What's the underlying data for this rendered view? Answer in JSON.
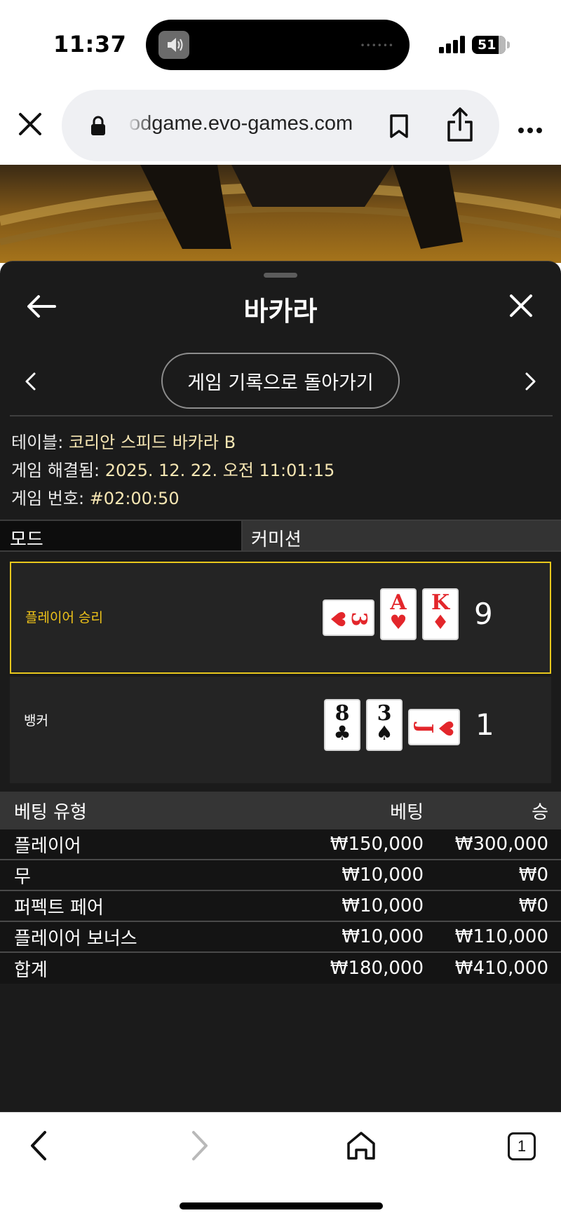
{
  "status": {
    "time": "11:37",
    "battery": "51"
  },
  "browser": {
    "url": "odgame.evo-games.com",
    "tabs_count": "1"
  },
  "panel": {
    "title": "바카라",
    "back_to_history": "게임 기록으로 돌아가기",
    "info": {
      "table_label": "테이블:",
      "table_value": "코리안 스피드 바카라 B",
      "resolved_label": "게임 해결됨:",
      "resolved_value": "2025. 12. 22. 오전 11:01:15",
      "game_no_label": "게임 번호:",
      "game_no_value": "#02:00:50"
    },
    "mode": {
      "label": "모드",
      "value": "커미션"
    }
  },
  "results": {
    "player": {
      "label": "플레이어 승리",
      "score": "9",
      "cards": [
        {
          "rank": "3",
          "suit": "♥",
          "color": "red",
          "orientation": "sideways"
        },
        {
          "rank": "A",
          "suit": "♥",
          "color": "red",
          "orientation": "upright"
        },
        {
          "rank": "K",
          "suit": "♦",
          "color": "red",
          "orientation": "upright"
        }
      ]
    },
    "banker": {
      "label": "뱅커",
      "score": "1",
      "cards": [
        {
          "rank": "8",
          "suit": "♣",
          "color": "black",
          "orientation": "upright"
        },
        {
          "rank": "3",
          "suit": "♠",
          "color": "black",
          "orientation": "upright"
        },
        {
          "rank": "J",
          "suit": "♥",
          "color": "red",
          "orientation": "sideways"
        }
      ]
    }
  },
  "bets": {
    "headers": {
      "type": "베팅 유형",
      "bet": "베팅",
      "win": "승"
    },
    "rows": [
      {
        "type": "플레이어",
        "bet": "₩150,000",
        "win": "₩300,000"
      },
      {
        "type": "무",
        "bet": "₩10,000",
        "win": "₩0"
      },
      {
        "type": "퍼펙트 페어",
        "bet": "₩10,000",
        "win": "₩0"
      },
      {
        "type": "플레이어 보너스",
        "bet": "₩10,000",
        "win": "₩110,000"
      }
    ],
    "total": {
      "type": "합계",
      "bet": "₩180,000",
      "win": "₩410,000"
    }
  },
  "colors": {
    "player_highlight": "#e8c71c",
    "panel_bg": "#1b1b1b",
    "card_red": "#e3262b"
  }
}
